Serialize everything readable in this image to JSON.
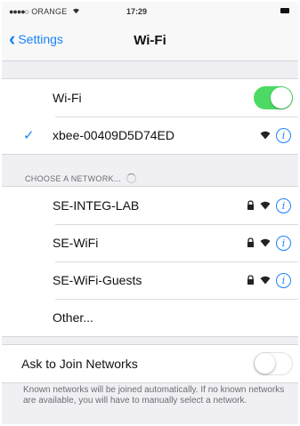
{
  "status_bar": {
    "carrier": "ORANGE",
    "time": "17:29"
  },
  "nav": {
    "back_label": "Settings",
    "title": "Wi-Fi"
  },
  "wifi": {
    "label": "Wi-Fi",
    "enabled": true,
    "connected_network": "xbee-00409D5D74ED"
  },
  "choose_network": {
    "header": "CHOOSE A NETWORK...",
    "networks": [
      {
        "name": "SE-INTEG-LAB",
        "secured": true
      },
      {
        "name": "SE-WiFi",
        "secured": true
      },
      {
        "name": "SE-WiFi-Guests",
        "secured": true
      }
    ],
    "other_label": "Other..."
  },
  "ask_to_join": {
    "label": "Ask to Join Networks",
    "enabled": false,
    "description": "Known networks will be joined automatically. If no known networks are available, you will have to manually select a network."
  },
  "colors": {
    "accent": "#1a82fb",
    "toggle_on": "#4cd964",
    "background": "#efeff4"
  },
  "icons": [
    "check-icon",
    "lock-icon",
    "wifi-icon",
    "info-icon",
    "spinner-icon",
    "chevron-left-icon",
    "battery-icon",
    "signal-icon",
    "wifi-status-icon"
  ]
}
